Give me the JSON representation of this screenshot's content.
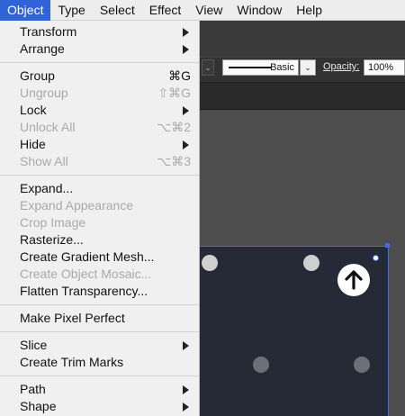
{
  "menubar": {
    "items": [
      {
        "label": "Object",
        "active": true
      },
      {
        "label": "Type"
      },
      {
        "label": "Select"
      },
      {
        "label": "Effect"
      },
      {
        "label": "View"
      },
      {
        "label": "Window"
      },
      {
        "label": "Help"
      }
    ]
  },
  "toolbar": {
    "stroke_label": "Basic",
    "opacity_label": "Opacity:",
    "opacity_value": "100%",
    "dropdown_glyph": "⌄"
  },
  "object_menu": {
    "groups": [
      [
        {
          "label": "Transform",
          "submenu": true
        },
        {
          "label": "Arrange",
          "submenu": true
        }
      ],
      [
        {
          "label": "Group",
          "shortcut": "⌘G"
        },
        {
          "label": "Ungroup",
          "shortcut": "⇧⌘G",
          "disabled": true
        },
        {
          "label": "Lock",
          "submenu": true
        },
        {
          "label": "Unlock All",
          "shortcut": "⌥⌘2",
          "disabled": true
        },
        {
          "label": "Hide",
          "submenu": true
        },
        {
          "label": "Show All",
          "shortcut": "⌥⌘3",
          "disabled": true
        }
      ],
      [
        {
          "label": "Expand..."
        },
        {
          "label": "Expand Appearance",
          "disabled": true
        },
        {
          "label": "Crop Image",
          "disabled": true
        },
        {
          "label": "Rasterize..."
        },
        {
          "label": "Create Gradient Mesh..."
        },
        {
          "label": "Create Object Mosaic...",
          "disabled": true
        },
        {
          "label": "Flatten Transparency..."
        }
      ],
      [
        {
          "label": "Make Pixel Perfect"
        }
      ],
      [
        {
          "label": "Slice",
          "submenu": true
        },
        {
          "label": "Create Trim Marks"
        }
      ],
      [
        {
          "label": "Path",
          "submenu": true
        },
        {
          "label": "Shape",
          "submenu": true
        }
      ]
    ]
  },
  "canvas": {
    "artboard_color": "#262a37",
    "selection_color": "#3d6ef0",
    "up_button_icon": "arrow-up-icon"
  }
}
